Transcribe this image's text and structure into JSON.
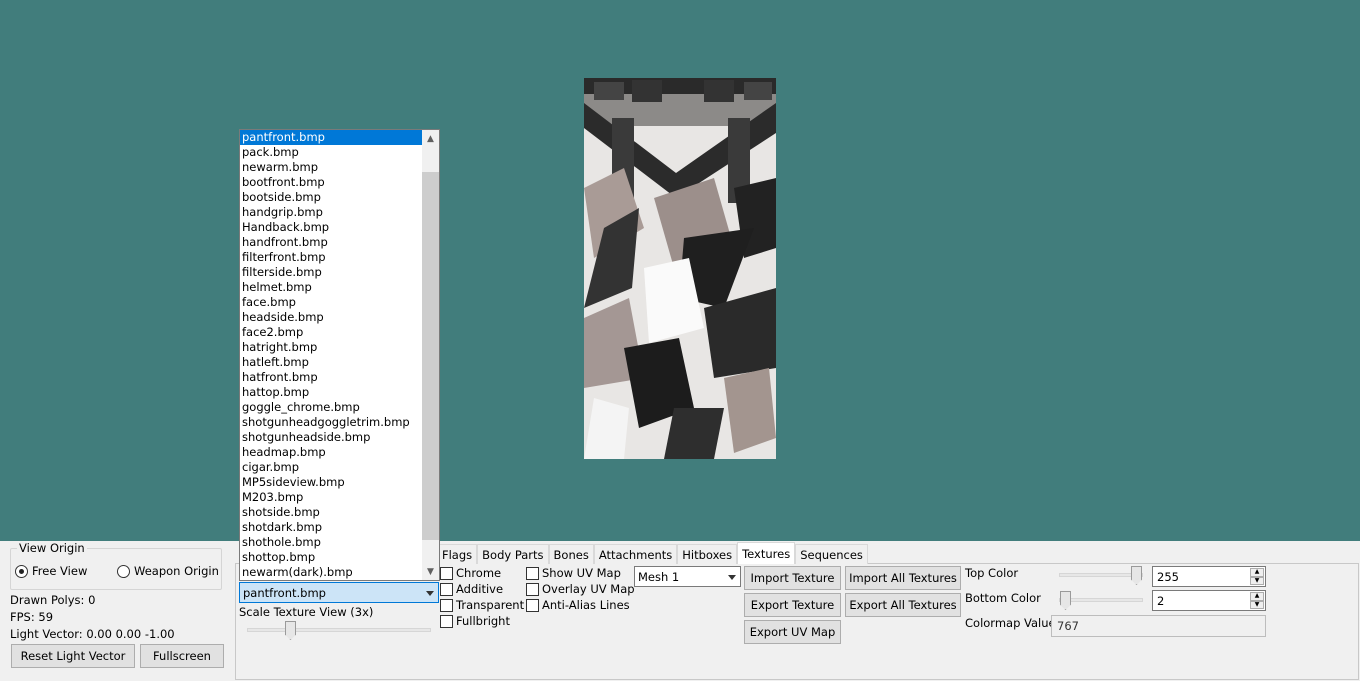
{
  "view_origin": {
    "legend": "View Origin",
    "free_view": "Free View",
    "weapon_origin": "Weapon Origin",
    "selected": "free_view"
  },
  "stats": {
    "drawn_polys": "Drawn Polys: 0",
    "fps": "FPS: 59",
    "light_vector": "Light Vector: 0.00 0.00 -1.00"
  },
  "buttons": {
    "reset_light_vector": "Reset Light Vector",
    "fullscreen": "Fullscreen",
    "import_texture": "Import Texture",
    "import_all_textures": "Import All Textures",
    "export_texture": "Export Texture",
    "export_all_textures": "Export All Textures",
    "export_uv_map": "Export UV Map"
  },
  "tabs": [
    "Flags",
    "Body Parts",
    "Bones",
    "Attachments",
    "Hitboxes",
    "Textures",
    "Sequences"
  ],
  "active_tab": "Textures",
  "texture_select": {
    "value": "pantfront.bmp",
    "options": [
      "pantfront.bmp",
      "pack.bmp",
      "newarm.bmp",
      "bootfront.bmp",
      "bootside.bmp",
      "handgrip.bmp",
      "Handback.bmp",
      "handfront.bmp",
      "filterfront.bmp",
      "filterside.bmp",
      "helmet.bmp",
      "face.bmp",
      "headside.bmp",
      "face2.bmp",
      "hatright.bmp",
      "hatleft.bmp",
      "hatfront.bmp",
      "hattop.bmp",
      "goggle_chrome.bmp",
      "shotgunheadgoggletrim.bmp",
      "shotgunheadside.bmp",
      "headmap.bmp",
      "cigar.bmp",
      "MP5sideview.bmp",
      "M203.bmp",
      "shotside.bmp",
      "shotdark.bmp",
      "shothole.bmp",
      "shottop.bmp",
      "newarm(dark).bmp"
    ]
  },
  "scale_label": "Scale Texture View (3x)",
  "flags_checkboxes": [
    "Chrome",
    "Additive",
    "Transparent",
    "Fullbright"
  ],
  "map_checkboxes": [
    "Show UV Map",
    "Overlay UV Map",
    "Anti-Alias Lines"
  ],
  "mesh_select": {
    "value": "Mesh 1"
  },
  "colors": {
    "top_label": "Top Color",
    "top_value": "255",
    "bottom_label": "Bottom Color",
    "bottom_value": "2",
    "colormap_label": "Colormap Value",
    "colormap_value": "767"
  },
  "theme": {
    "viewport_bg": "#417d7c",
    "selection": "#0078d7",
    "panel_bg": "#f0f0f0"
  }
}
